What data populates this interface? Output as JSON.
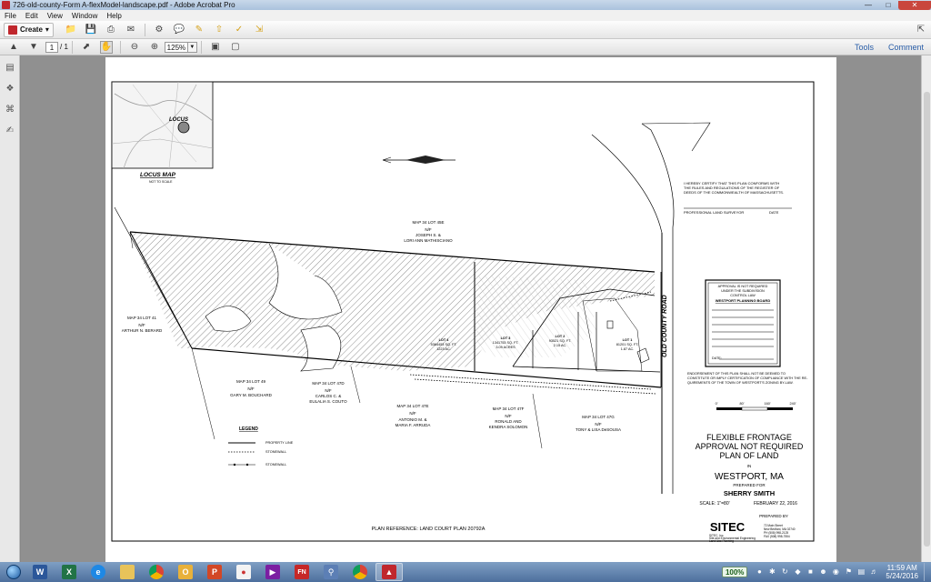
{
  "window": {
    "title": "726-old-county-Form A-flexModel-landscape.pdf - Adobe Acrobat Pro"
  },
  "menu": [
    "File",
    "Edit",
    "View",
    "Window",
    "Help"
  ],
  "toolbar": {
    "create_label": "Create",
    "page_current": "1",
    "page_total": "/ 1",
    "zoom": "125%",
    "tools_label": "Tools",
    "comment_label": "Comment"
  },
  "plan": {
    "locus_label": "LOCUS",
    "locus_map_title": "LOCUS MAP",
    "not_to_scale": "NOT TO SCALE",
    "certify_text": [
      "I HEREBY CERTIFY THAT THIS PLAN CONFORMS WITH",
      "THE RULES AND REGULATIONS OF THE REGISTER OF",
      "DEEDS OF THE COMMONWEALTH OF MASSACHUSETTS."
    ],
    "surveyor_label": "PROFESSIONAL LAND SURVEYOR",
    "date_label": "DATE",
    "approval_lines": [
      "APPROVAL IS NOT REQUIRED",
      "UNDER THE SUBDIVISION",
      "CONTROL LAW"
    ],
    "planning_board": "WESTPORT PLANNING BOARD",
    "approval_date": "DATE:",
    "endorsement_text": [
      "ENDORSEMENT OF THIS PLAN SHALL NOT BE DEEMED TO",
      "CONSTITUTE OR IMPLY CERTIFICATION OF COMPLIANCE WITH THE RE-",
      "QUIREMENTS OF THE TOWN OF WESTPORT'S ZONING BY-LAW."
    ],
    "scale_ticks": [
      "0'",
      "80'",
      "160'",
      "240'"
    ],
    "road_name": "OLD COUNTY ROAD",
    "parcels": [
      {
        "lot": "MAP 34 LOT 45E",
        "nf": "N/F",
        "owner1": "JOSEPH S. &",
        "owner2": "LORI ANN MATHISCIANO"
      },
      {
        "lot": "MAP 34 LOT 41",
        "nf": "N/F",
        "owner1": "ARTHUR N. BERARD",
        "owner2": ""
      },
      {
        "lot": "MAP 34 LOT 49",
        "nf": "N/F",
        "owner1": "GARY M. BOUCHARD",
        "owner2": ""
      },
      {
        "lot": "MAP 34 LOT 47D",
        "nf": "N/F",
        "owner1": "CARLOS C. &",
        "owner2": "EULALIA S. COUTO"
      },
      {
        "lot": "MAP 34 LOT 47E",
        "nf": "N/F",
        "owner1": "ANTONIO M. &",
        "owner2": "MARIA F. ARRUDA"
      },
      {
        "lot": "MAP 34 LOT 47F",
        "nf": "N/F",
        "owner1": "RONALD AND",
        "owner2": "KENDRA SOLOMON"
      },
      {
        "lot": "MAP 34 LOT 47G",
        "nf": "N/F",
        "owner1": "TONY & LISA DeSOUSA",
        "owner2": ""
      }
    ],
    "lots": [
      {
        "name": "LOT 4",
        "area1": "5364453 SQ. FT.",
        "area2": "1223 AC."
      },
      {
        "name": "LOT 3",
        "area1": "1341753 SQ. FT.",
        "area2": "3.09 ACRES"
      },
      {
        "name": "LOT 2",
        "area1": "93521 SQ. FT.",
        "area2": "2.15 AC."
      },
      {
        "name": "LOT 1",
        "area1": "81201 SQ. FT.",
        "area2": "1.87 AC."
      }
    ],
    "legend_title": "LEGEND",
    "legend_items": [
      "PROPERTY LINE",
      "STONEWALL",
      "STONEWALL"
    ],
    "plan_reference": "PLAN REFERENCE: LAND COURT PLAN 20792A",
    "title_lines": [
      "FLEXIBLE FRONTAGE",
      "APPROVAL NOT REQUIRED",
      "PLAN OF LAND"
    ],
    "in_label": "IN",
    "town": "WESTPORT, MA",
    "prepared_for_label": "PREPARED FOR",
    "client": "SHERRY SMITH",
    "scale": "SCALE: 1\"=80'",
    "date": "FEBRUARY 22, 2016",
    "prepared_by_label": "PREPARED BY",
    "firm": "SITEC",
    "firm_small": "SITEC, Inc.",
    "firm_desc": [
      "Site and Environmental Engineering",
      "Land Use Planning"
    ],
    "firm_address": [
      "72 Main Street",
      "New Bedford, MA 02740",
      "PH (508) 998-2125",
      "FAX (508) 998-7554"
    ]
  },
  "taskbar": {
    "zoom_badge": "100%",
    "time": "11:59 AM",
    "date": "5/24/2016"
  }
}
